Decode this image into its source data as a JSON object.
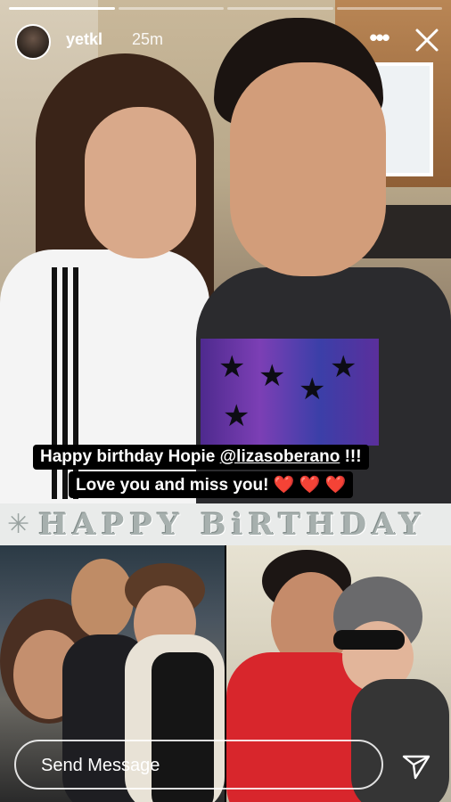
{
  "story": {
    "progress": {
      "segments": 4,
      "current": 1
    },
    "user": {
      "username": "yetkl",
      "time_ago": "25m"
    },
    "caption": {
      "line1_prefix": "Happy birthday Hopie ",
      "mention": "@lizasoberano",
      "line1_suffix": " !!!",
      "line2_text": "Love you and miss you! ",
      "hearts": "❤️ ❤️ ❤️"
    },
    "banner": {
      "text": "HAPPY BiRTHDAY",
      "decoration": "✳"
    }
  },
  "footer": {
    "message_placeholder": "Send Message"
  },
  "icons": {
    "more": "more-horizontal-icon",
    "close": "close-icon",
    "send": "send-paper-plane-icon"
  }
}
